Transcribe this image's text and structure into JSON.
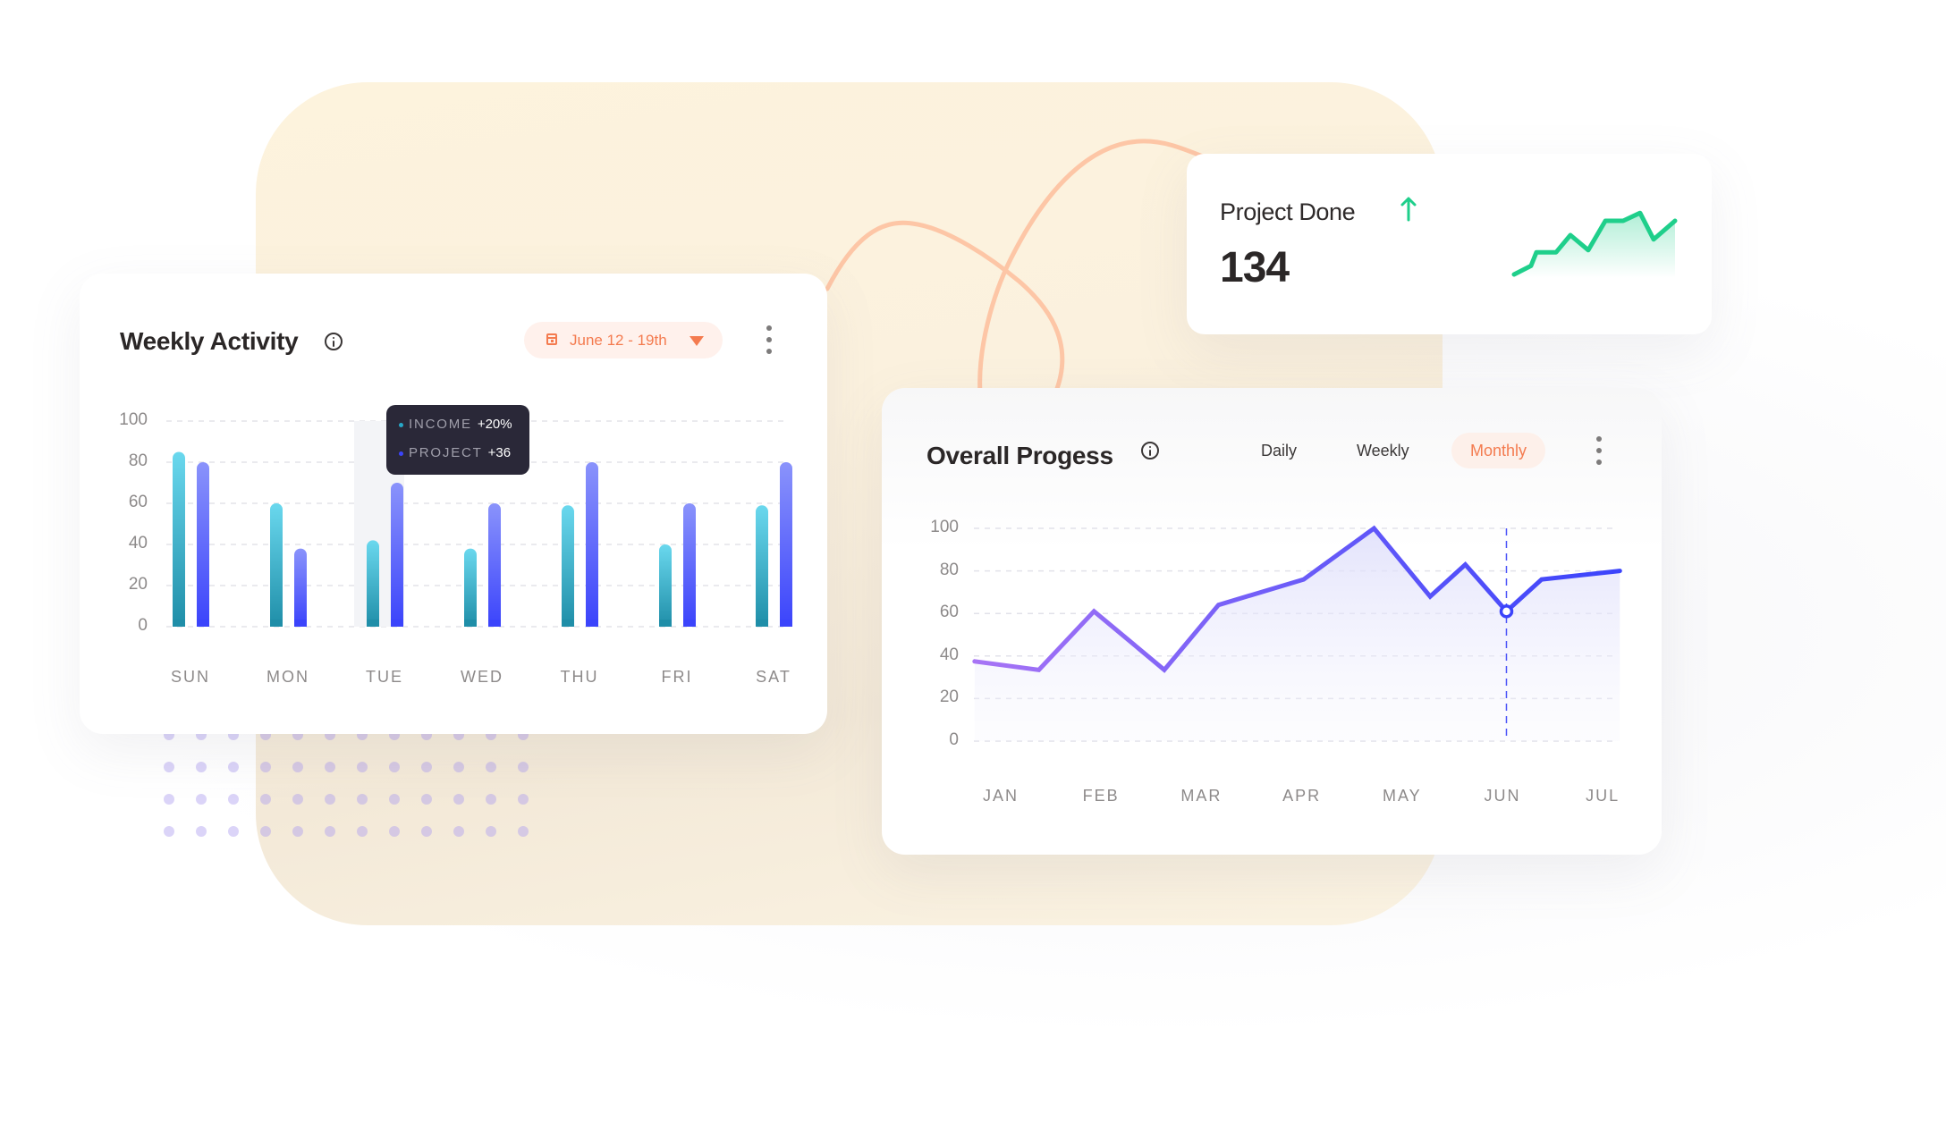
{
  "colors": {
    "accent_orange": "#f47b4f",
    "income_gradient": [
      "#6ad8ee",
      "#1f8ea8"
    ],
    "project_gradient": [
      "#8a93fb",
      "#3b44fb"
    ],
    "line_start": "#a774f5",
    "line_end": "#3b44fb",
    "sparkline": "#1fcf8b",
    "tooltip_bg": "#2a2838",
    "blob": "#fdf3dd",
    "decor_curve": "#fdc6a6",
    "dots": "#c9c0f6"
  },
  "weekly_activity": {
    "title": "Weekly Activity",
    "info_icon": "info-icon",
    "date_range": "June 12 - 19th",
    "calendar_icon": "calendar-icon",
    "dropdown_icon": "caret-down-icon",
    "menu_icon": "kebab-menu-icon",
    "tooltip": {
      "day": "TUE",
      "rows": [
        {
          "label": "INCOME",
          "value": "+20%"
        },
        {
          "label": "PROJECT",
          "value": "+36"
        }
      ]
    }
  },
  "project_done": {
    "title": "Project Done",
    "trend_icon": "arrow-up-icon",
    "value": "134",
    "sparkline": [
      5,
      17,
      36,
      36,
      60,
      39,
      80,
      80,
      91,
      54,
      80
    ]
  },
  "overall_progress": {
    "title": "Overall Progess",
    "info_icon": "info-icon",
    "tabs": [
      {
        "label": "Daily",
        "active": false
      },
      {
        "label": "Weekly",
        "active": false
      },
      {
        "label": "Monthly",
        "active": true
      }
    ],
    "menu_icon": "kebab-menu-icon"
  },
  "chart_data": [
    {
      "type": "bar",
      "title": "Weekly Activity",
      "categories": [
        "SUN",
        "MON",
        "TUE",
        "WED",
        "THU",
        "FRI",
        "SAT"
      ],
      "series": [
        {
          "name": "Income",
          "values": [
            85,
            60,
            42,
            38,
            59,
            40,
            59
          ]
        },
        {
          "name": "Project",
          "values": [
            80,
            38,
            70,
            60,
            80,
            60,
            80
          ]
        }
      ],
      "yticks": [
        "0",
        "20",
        "40",
        "60",
        "80",
        "100"
      ],
      "ylim": [
        0,
        100
      ],
      "grid": true,
      "highlighted_category": "TUE",
      "xlabel": "",
      "ylabel": ""
    },
    {
      "type": "area",
      "title": "Overall Progess",
      "categories": [
        "JAN",
        "FEB",
        "MAR",
        "APR",
        "MAY",
        "JUN",
        "JUL"
      ],
      "points": [
        {
          "x": -0.26,
          "y": 37.5
        },
        {
          "x": 0.38,
          "y": 33.5
        },
        {
          "x": 0.93,
          "y": 61
        },
        {
          "x": 1.63,
          "y": 33.5
        },
        {
          "x": 2.17,
          "y": 64
        },
        {
          "x": 3.02,
          "y": 76
        },
        {
          "x": 3.72,
          "y": 100
        },
        {
          "x": 4.28,
          "y": 68
        },
        {
          "x": 4.63,
          "y": 83
        },
        {
          "x": 5.04,
          "y": 61
        },
        {
          "x": 5.39,
          "y": 76
        },
        {
          "x": 6.17,
          "y": 80
        }
      ],
      "marker": {
        "x": 5.04,
        "y": 61,
        "label": "JUN"
      },
      "yticks": [
        "0",
        "20",
        "40",
        "60",
        "80",
        "100"
      ],
      "ylim": [
        0,
        100
      ],
      "grid": true,
      "xlabel": "",
      "ylabel": ""
    }
  ]
}
